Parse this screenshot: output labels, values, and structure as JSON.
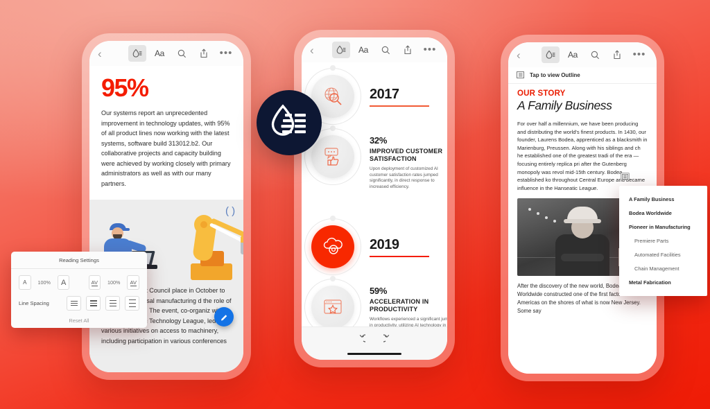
{
  "brand": {
    "logo_icon": "liquid-mode-droplet-icon",
    "logo_bg": "#0d1733"
  },
  "background": {
    "gradient_from": "#f49486",
    "gradient_to": "#ef1b05"
  },
  "toolbar": {
    "back_icon": "chevron-left-icon",
    "liquid_mode_icon": "liquid-mode-icon",
    "text_settings_label": "Aa",
    "search_icon": "search-icon",
    "share_icon": "share-icon",
    "more_label": "•••"
  },
  "phone1": {
    "stat": "95%",
    "paragraph": "Our systems report an unprecedented improvement in technology updates, with 95% of all product lines now working with the latest systems, software build 313012.b2. Our collaborative projects and capacity building were achieved by working closely with primary administrators as well as with our many partners.",
    "figure_alt": "worker-with-laptop-and-robot-arm-illustration",
    "tail_paragraph": "ical Advanement Council place in October to discuss n universal manufacturing d the role of robotics and ing. The event, co-organiz with the Asian Pacific Technology League, led various initiatives on access to machinery, including participation in various conferences",
    "reading_settings": {
      "title": "Reading Settings",
      "font_small_label": "A",
      "font_size_pct": "100%",
      "font_large_label": "A",
      "spacing_small_label": "AV",
      "spacing_pct": "100%",
      "spacing_large_label": "AV",
      "line_spacing_label": "Line Spacing",
      "reset_label": "Reset All"
    },
    "fab_icon": "edit-pencil-icon"
  },
  "phone2": {
    "items": [
      {
        "kind": "year",
        "year": "2017",
        "icon": "globe-search-icon",
        "highlight": false
      },
      {
        "kind": "stat",
        "pct": "32%",
        "heading": "IMPROVED CUSTOMER SATISFACTION",
        "desc": "Upon deployment of customized AI customer satisfaction rates jumped significantly, in direct response to increased efficiency.",
        "icon": "chat-thumbsup-icon",
        "highlight": false
      },
      {
        "kind": "year",
        "year": "2019",
        "icon": "cloud-gear-icon",
        "highlight": true
      },
      {
        "kind": "stat",
        "pct": "59%",
        "heading": "ACCELERATION IN PRODUCTIVITY",
        "desc": "Workflows experienced a significant jump in productivity, utilizing AI technology in the automation of repetitive workflows, vastly improving overall efficiency.",
        "icon": "browser-star-icon",
        "highlight": false
      }
    ],
    "undo_icon": "undo-icon",
    "redo_icon": "redo-icon"
  },
  "phone3": {
    "outline_bar": {
      "icon": "outline-icon",
      "label": "Tap to view Outline"
    },
    "kicker": "OUR STORY",
    "title": "A Family Business",
    "paragraph": "For over half a millennium, we have been producing and distributing the world's finest products. In 1430, our founder, Laurens Bodea, apprenticed as a blacksmith in Marienburg, Preussen. Along with his siblings and ch he established one of the greatest tradi of the era — focusing entirely replica pri after the Gutenberg monopoly was revol mid-15th century. Bodea established ko throughout Central Europe and became influence in the Hanseatic League.",
    "photo_alt": "factory-worker-portrait-photo",
    "paragraph2": "After the discovery of the new world, Bodea Worldwide constructed one of the first factories in the Americas on the shores of what is now New Jersey. Some say",
    "outline_menu": {
      "icon": "outline-icon",
      "items": [
        {
          "label": "A Family Business",
          "level": 1
        },
        {
          "label": "Bodea Worldwide",
          "level": 1
        },
        {
          "label": "Pioneer in Manufacturing",
          "level": 1
        },
        {
          "label": "Premiere Parts",
          "level": 2
        },
        {
          "label": "Automated Facilities",
          "level": 2
        },
        {
          "label": "Chain Management",
          "level": 2
        },
        {
          "label": "Metal Fabrication",
          "level": 1
        }
      ]
    }
  }
}
